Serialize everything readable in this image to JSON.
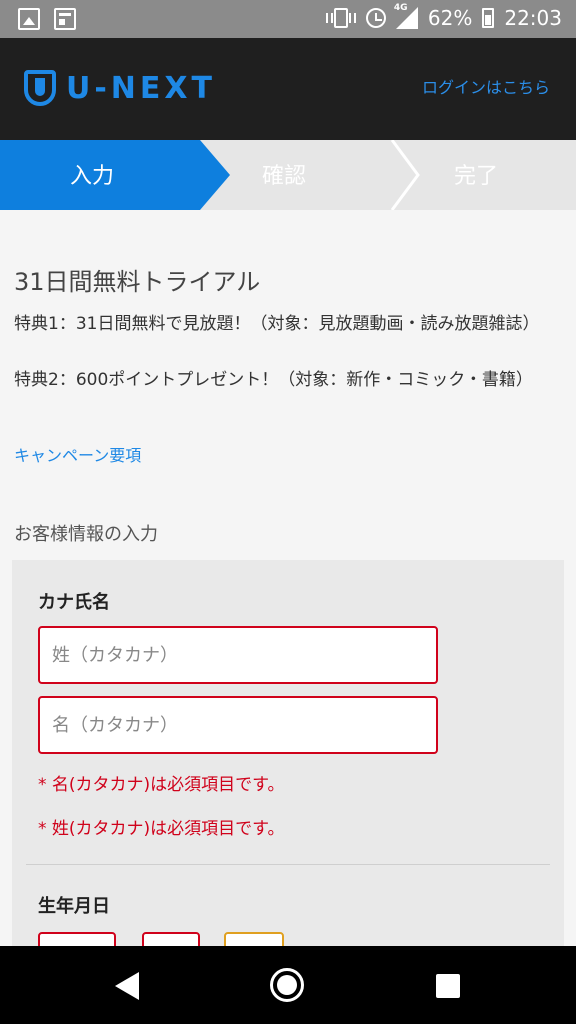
{
  "status_bar": {
    "network": "4G",
    "battery": "62%",
    "time": "22:03",
    "icons": [
      "gallery-icon",
      "news-icon",
      "vibrate-icon",
      "alarm-icon",
      "signal-icon",
      "battery-icon"
    ]
  },
  "header": {
    "logo_text": "U-NEXT",
    "login_link": "ログインはこちら"
  },
  "steps": {
    "items": [
      "入力",
      "確認",
      "完了"
    ],
    "active_index": 0
  },
  "main": {
    "trial_title": "31日間無料トライアル",
    "benefit_1": "特典1：31日間無料で見放題！（対象：見放題動画・読み放題雑誌）",
    "benefit_2": "特典2：600ポイントプレゼント！（対象：新作・コミック・書籍）",
    "campaign_link": "キャンペーン要項",
    "section_title": "お客様情報の入力"
  },
  "form": {
    "kana_label": "カナ氏名",
    "last_name_placeholder": "姓（カタカナ）",
    "first_name_placeholder": "名（カタカナ）",
    "error_first": "* 名(カタカナ)は必須項目です。",
    "error_last": "* 姓(カタカナ)は必須項目です。",
    "dob_label": "生年月日"
  },
  "colors": {
    "brand": "#1e88e5",
    "error": "#d0021b",
    "header_bg": "#1f1f1f",
    "active_step": "#0e7fde"
  }
}
